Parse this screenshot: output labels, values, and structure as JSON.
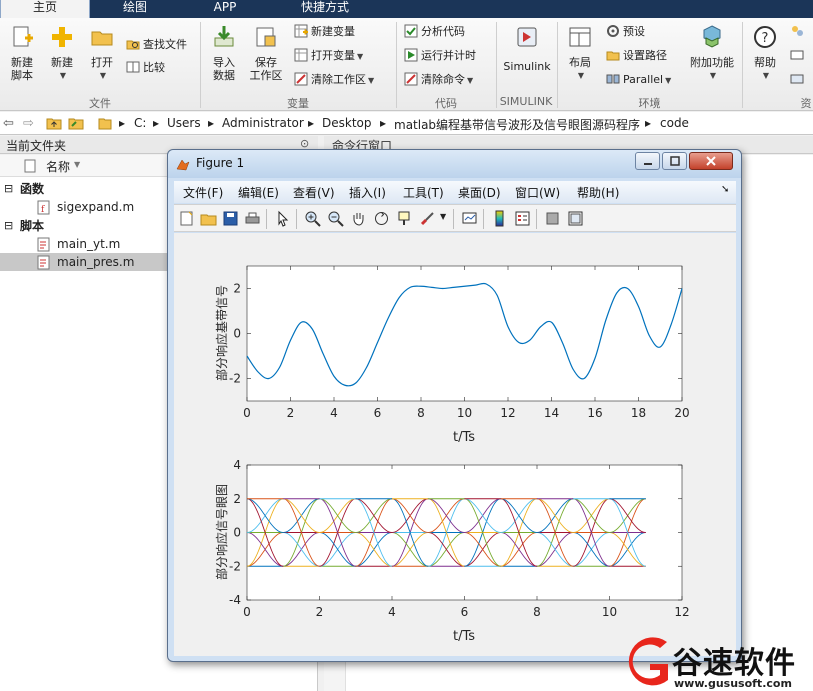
{
  "tabs": [
    {
      "label": "主页",
      "active": true
    },
    {
      "label": "绘图",
      "active": false
    },
    {
      "label": "APP",
      "active": false
    },
    {
      "label": "快捷方式",
      "active": false
    }
  ],
  "ribbon": {
    "file": {
      "label": "文件",
      "new_script": "新建\n脚本",
      "new": "新建",
      "open": "打开",
      "find_files": "查找文件",
      "compare": "比较"
    },
    "variable": {
      "label": "变量",
      "import": "导入\n数据",
      "save_ws": "保存\n工作区",
      "new_var": "新建变量",
      "open_var": "打开变量",
      "clear_ws": "清除工作区"
    },
    "code": {
      "label": "代码",
      "analyze": "分析代码",
      "run_time": "运行并计时",
      "clear_cmd": "清除命令"
    },
    "simulink": {
      "label": "SIMULINK",
      "btn": "Simulink"
    },
    "env": {
      "label": "环境",
      "layout": "布局",
      "prefs": "预设",
      "set_path": "设置路径",
      "parallel": "Parallel",
      "addons": "附加功能"
    },
    "resources": {
      "label": "资",
      "help": "帮助"
    }
  },
  "address": {
    "crumbs": [
      "C:",
      "Users",
      "Administrator",
      "Desktop",
      "matlab编程基带信号波形及信号眼图源码程序",
      "code"
    ]
  },
  "left_panel": {
    "title": "当前文件夹",
    "col_name": "名称",
    "groups": [
      {
        "label": "函数",
        "files": [
          "sigexpand.m"
        ]
      },
      {
        "label": "脚本",
        "files": [
          "main_yt.m",
          "main_pres.m"
        ]
      }
    ]
  },
  "right_panel": {
    "title": "命令行窗口"
  },
  "figure": {
    "title": "Figure 1",
    "menu": [
      "文件(F)",
      "编辑(E)",
      "查看(V)",
      "插入(I)",
      "工具(T)",
      "桌面(D)",
      "窗口(W)",
      "帮助(H)"
    ]
  },
  "chart_data": [
    {
      "type": "line",
      "title": "",
      "xlabel": "t/Ts",
      "ylabel": "部分响应基带信号",
      "xlim": [
        0,
        20
      ],
      "ylim": [
        -3,
        3
      ],
      "xticks": [
        0,
        2,
        4,
        6,
        8,
        10,
        12,
        14,
        16,
        18,
        20
      ],
      "yticks": [
        -2,
        0,
        2
      ],
      "series": [
        {
          "x": [
            0,
            0.5,
            1,
            1.5,
            2,
            2.5,
            3,
            3.5,
            4,
            4.5,
            5,
            5.5,
            6,
            6.5,
            7,
            7.5,
            8,
            8.5,
            9,
            9.5,
            10,
            10.5,
            11,
            11.5,
            12,
            12.5,
            13,
            13.5,
            14,
            14.5,
            15,
            15.5,
            16,
            16.5,
            17,
            17.5,
            18,
            18.5,
            19,
            19.5,
            20
          ],
          "y": [
            -1.0,
            -1.7,
            -2.0,
            -1.5,
            -0.3,
            0.5,
            0.2,
            -0.9,
            -1.9,
            -2.3,
            -2.2,
            -1.5,
            -0.4,
            0.7,
            1.6,
            2.05,
            2.1,
            2.05,
            2.0,
            2.05,
            2.1,
            2.15,
            2.2,
            1.7,
            0.3,
            -0.4,
            -0.3,
            0.3,
            0.5,
            -0.4,
            -1.6,
            -2.0,
            -1.1,
            0.6,
            1.8,
            2.0,
            1.2,
            -0.1,
            -0.6,
            0.4,
            2.0
          ],
          "color": "#0072bd"
        }
      ]
    },
    {
      "type": "line",
      "title": "",
      "xlabel": "t/Ts",
      "ylabel": "部分响应信号眼图",
      "xlim": [
        0,
        12
      ],
      "ylim": [
        -4,
        4
      ],
      "xticks": [
        0,
        2,
        4,
        6,
        8,
        10,
        12
      ],
      "yticks": [
        -4,
        -2,
        0,
        2,
        4
      ],
      "eye": {
        "periods": 11,
        "levels": [
          -2,
          0,
          2
        ],
        "colors": [
          "#0072bd",
          "#d95319",
          "#edb120",
          "#7e2f8e",
          "#77ac30",
          "#4dbeee",
          "#a2142f"
        ]
      }
    }
  ],
  "logo": {
    "name": "谷速软件",
    "url": "www.gususoft.com"
  }
}
